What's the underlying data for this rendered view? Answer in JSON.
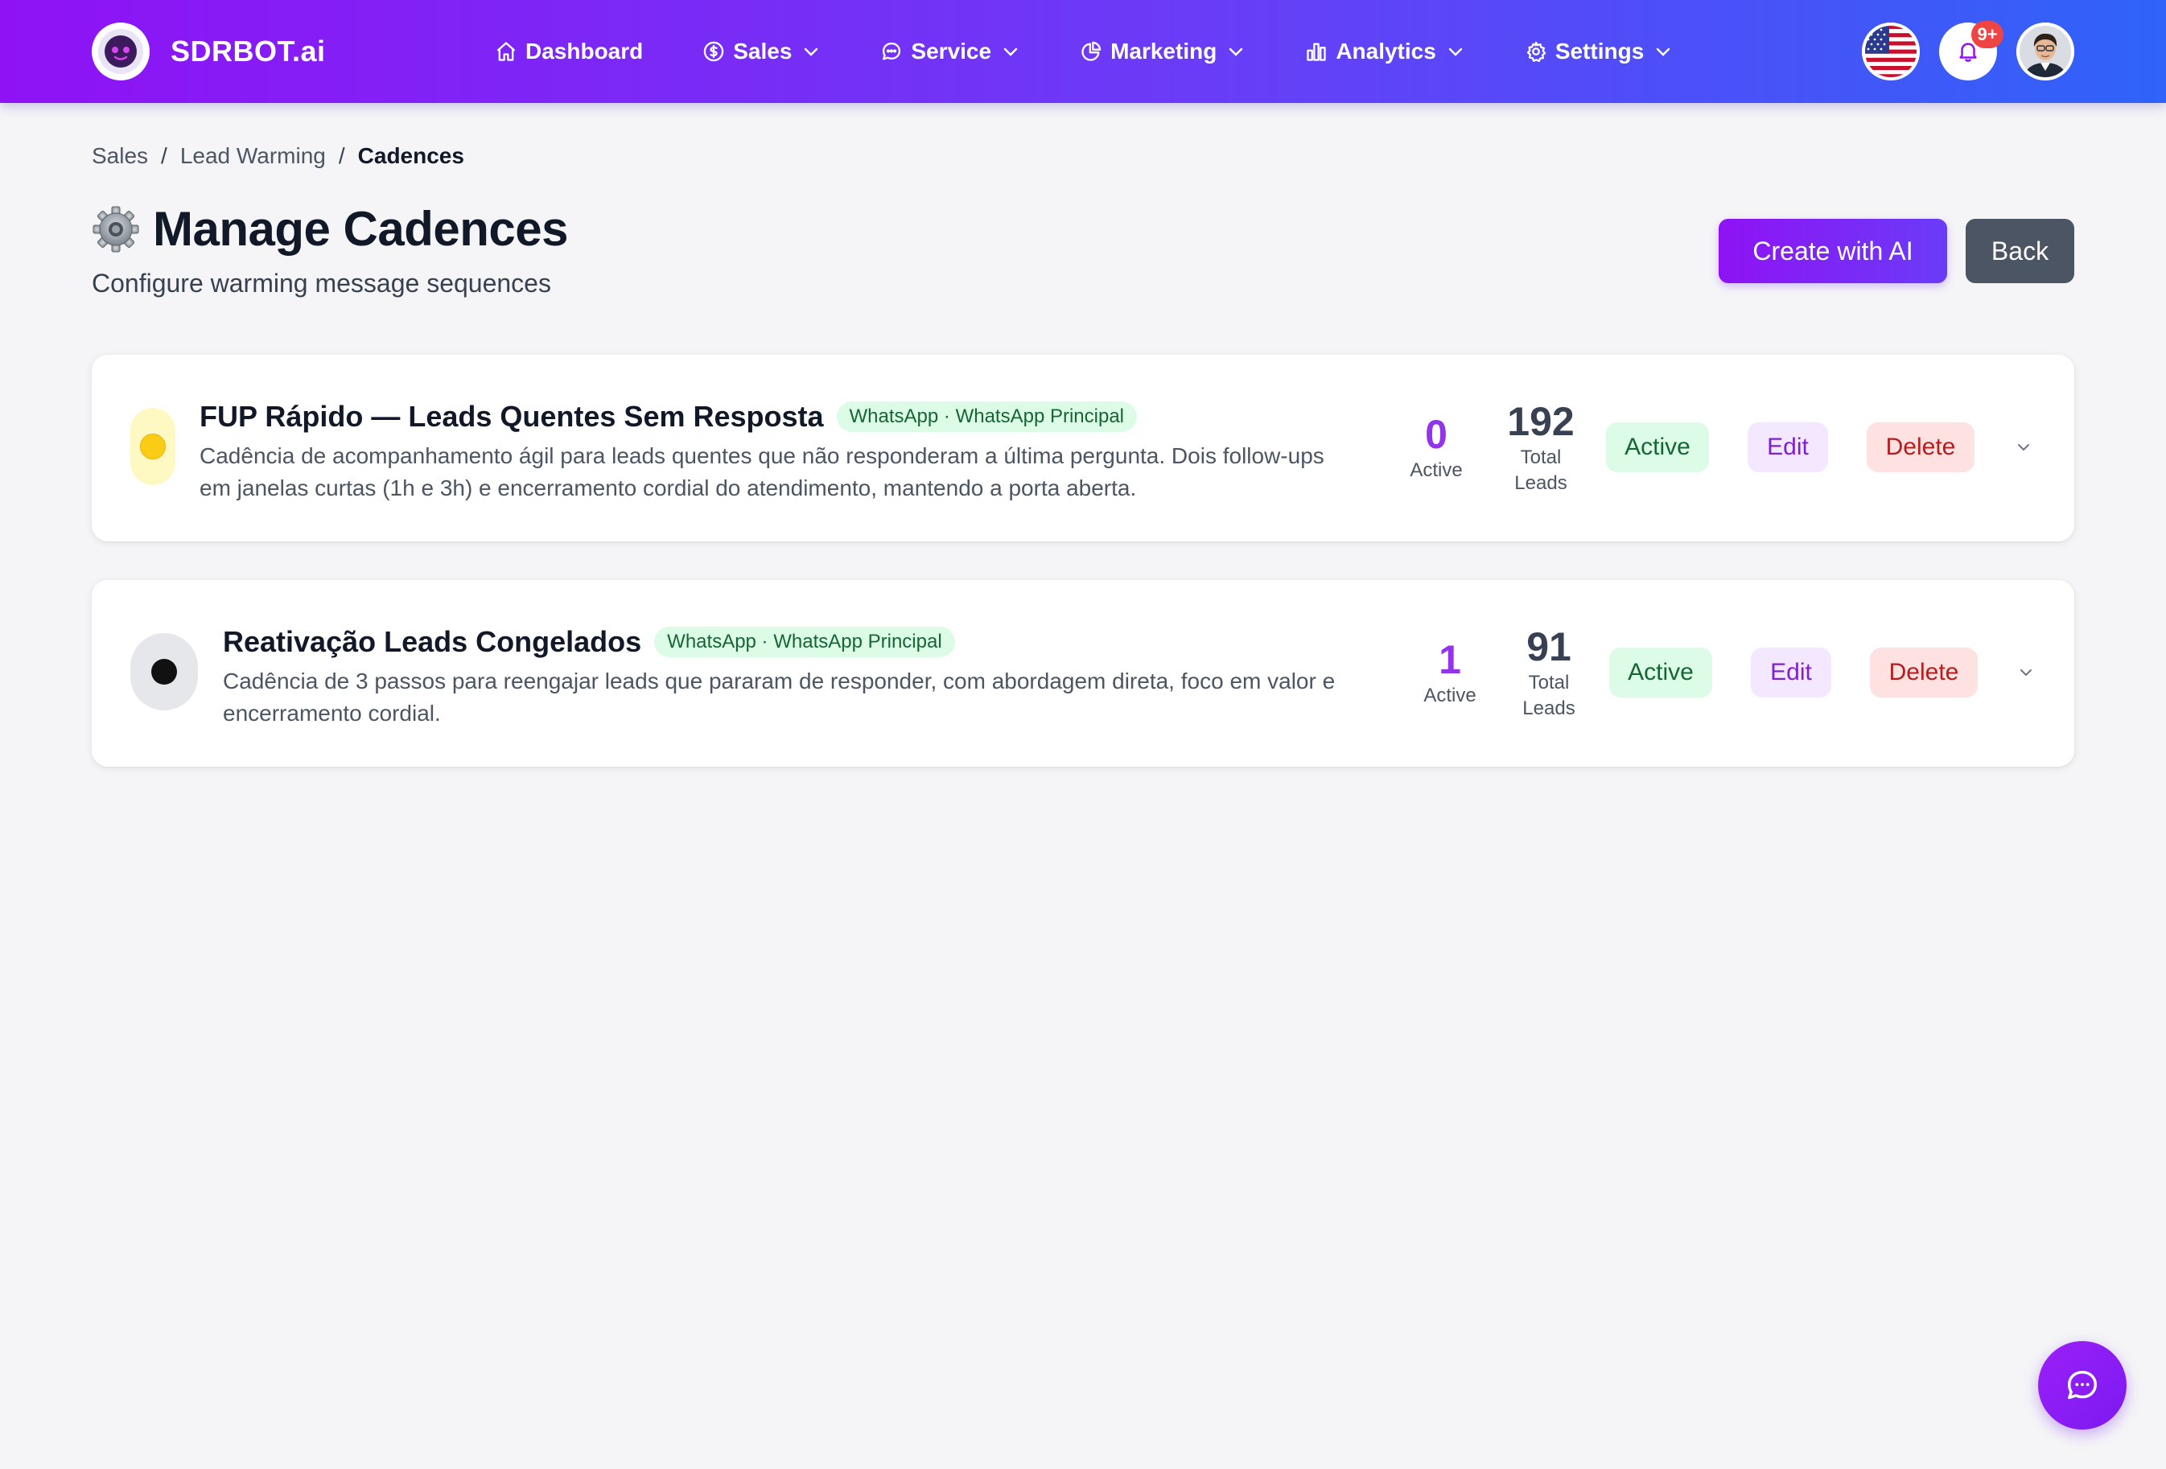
{
  "brand": {
    "name": "SDRBOT.ai"
  },
  "nav": {
    "items": [
      {
        "label": "Dashboard",
        "icon": "home-icon",
        "dropdown": false
      },
      {
        "label": "Sales",
        "icon": "dollar-icon",
        "dropdown": true
      },
      {
        "label": "Service",
        "icon": "chat-bubble-icon",
        "dropdown": true
      },
      {
        "label": "Marketing",
        "icon": "pie-chart-icon",
        "dropdown": true
      },
      {
        "label": "Analytics",
        "icon": "bar-chart-icon",
        "dropdown": true
      },
      {
        "label": "Settings",
        "icon": "gear-icon",
        "dropdown": true
      }
    ],
    "notifications_badge": "9+"
  },
  "breadcrumb": {
    "items": [
      "Sales",
      "Lead Warming"
    ],
    "current": "Cadences",
    "separator": "/"
  },
  "header": {
    "title": "Manage Cadences",
    "subtitle": "Configure warming message sequences",
    "create_ai_label": "Create with AI",
    "back_label": "Back"
  },
  "cadences": [
    {
      "status_dot_color": "#facc15",
      "name": "FUP Rápido — Leads Quentes Sem Resposta",
      "channel": "WhatsApp · WhatsApp Principal",
      "description_line1": "Cadência de acompanhamento ágil para leads quentes que não responderam a última pergunta. Dois follow-ups",
      "description_line2": "em janelas curtas (1h e 3h) e encerramento cordial do atendimento, mantendo a porta aberta.",
      "active_count": "0",
      "active_label": "Active",
      "total_count": "192",
      "total_label_1": "Total",
      "total_label_2": "Leads",
      "status_label": "Active",
      "edit_label": "Edit",
      "delete_label": "Delete"
    },
    {
      "status_dot_color": "#111111",
      "name": "Reativação Leads Congelados",
      "channel": "WhatsApp · WhatsApp Principal",
      "description_line1": "Cadência de 3 passos para reengajar leads que pararam de responder, com abordagem direta, foco em valor e",
      "description_line2": "encerramento cordial.",
      "active_count": "1",
      "active_label": "Active",
      "total_count": "91",
      "total_label_1": "Total",
      "total_label_2": "Leads",
      "status_label": "Active",
      "edit_label": "Edit",
      "delete_label": "Delete"
    }
  ],
  "colors": {
    "brand_start": "#8f12f5",
    "brand_end": "#2f63f9",
    "active_count": "#9333ea",
    "total_count": "#374151"
  }
}
